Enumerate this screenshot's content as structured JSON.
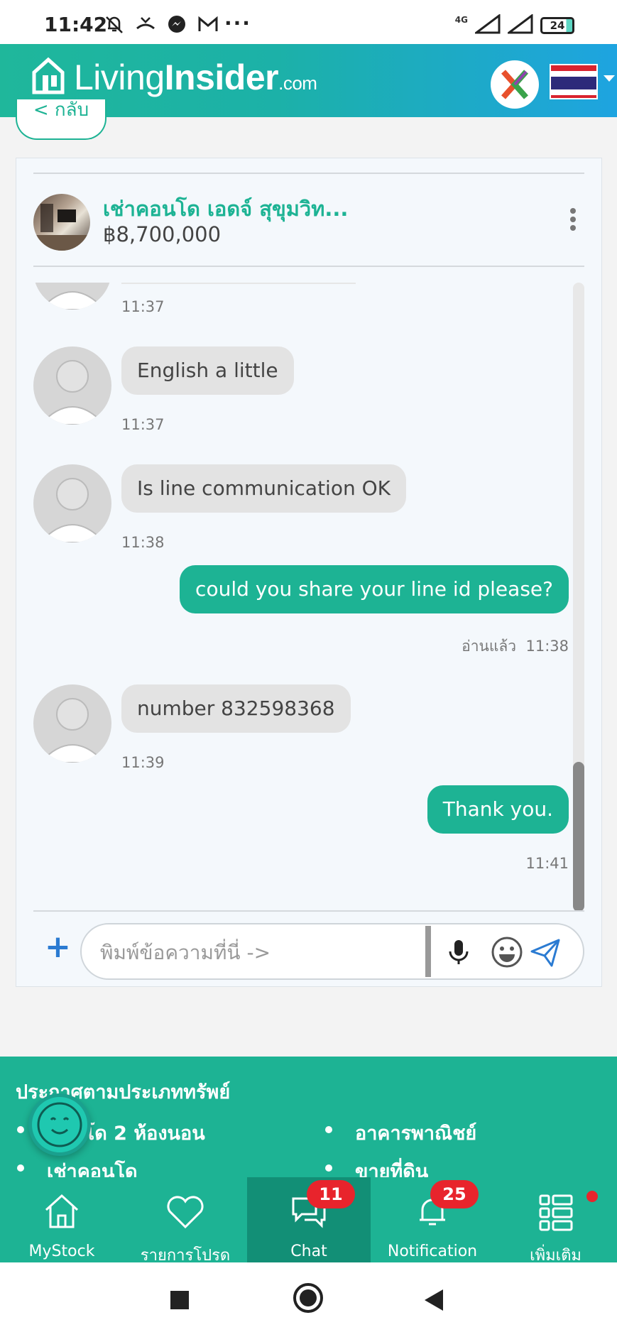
{
  "status_bar": {
    "time": "11:42",
    "network": "4G",
    "battery": "24",
    "more": "···"
  },
  "header": {
    "logo_light": "Living",
    "logo_bold": "Insider",
    "logo_suffix": ".com"
  },
  "back_button": {
    "label": "< กลับ"
  },
  "listing": {
    "title": "เช่าคอนโด เอดจ์ สุขุมวิท...",
    "price": "฿8,700,000"
  },
  "messages": [
    {
      "direction": "in",
      "text": "",
      "time": "11:37"
    },
    {
      "direction": "in",
      "text": "English a little",
      "time": "11:37"
    },
    {
      "direction": "in",
      "text": "Is line communication OK",
      "time": "11:38"
    },
    {
      "direction": "out",
      "text": "could you share your line id please?",
      "status": "อ่านแล้ว",
      "time": "11:38"
    },
    {
      "direction": "in",
      "text": "number 832598368",
      "time": "11:39"
    },
    {
      "direction": "out",
      "text": "Thank you.",
      "time": "11:41"
    }
  ],
  "composer": {
    "placeholder": "พิมพ์ข้อความที่นี่ ->"
  },
  "footer": {
    "title": "ประกาศตามประเภททรัพย์",
    "left_items": [
      "คอนโด 2 ห้องนอน",
      "เช่าคอนโด"
    ],
    "right_items": [
      "อาคารพาณิชย์",
      "ขายที่ดิน"
    ]
  },
  "bottom_nav": [
    {
      "label": "MyStock",
      "icon": "home-icon"
    },
    {
      "label": "รายการโปรด",
      "icon": "heart-icon"
    },
    {
      "label": "Chat",
      "icon": "chat-icon",
      "badge": "11",
      "active": true
    },
    {
      "label": "Notification",
      "icon": "bell-icon",
      "badge": "25"
    },
    {
      "label": "เพิ่มเติม",
      "icon": "menu-grid-icon",
      "dot": true
    }
  ],
  "colors": {
    "brand_green": "#1db394",
    "brand_blue": "#1ea4e0",
    "badge_red": "#e8242c"
  }
}
